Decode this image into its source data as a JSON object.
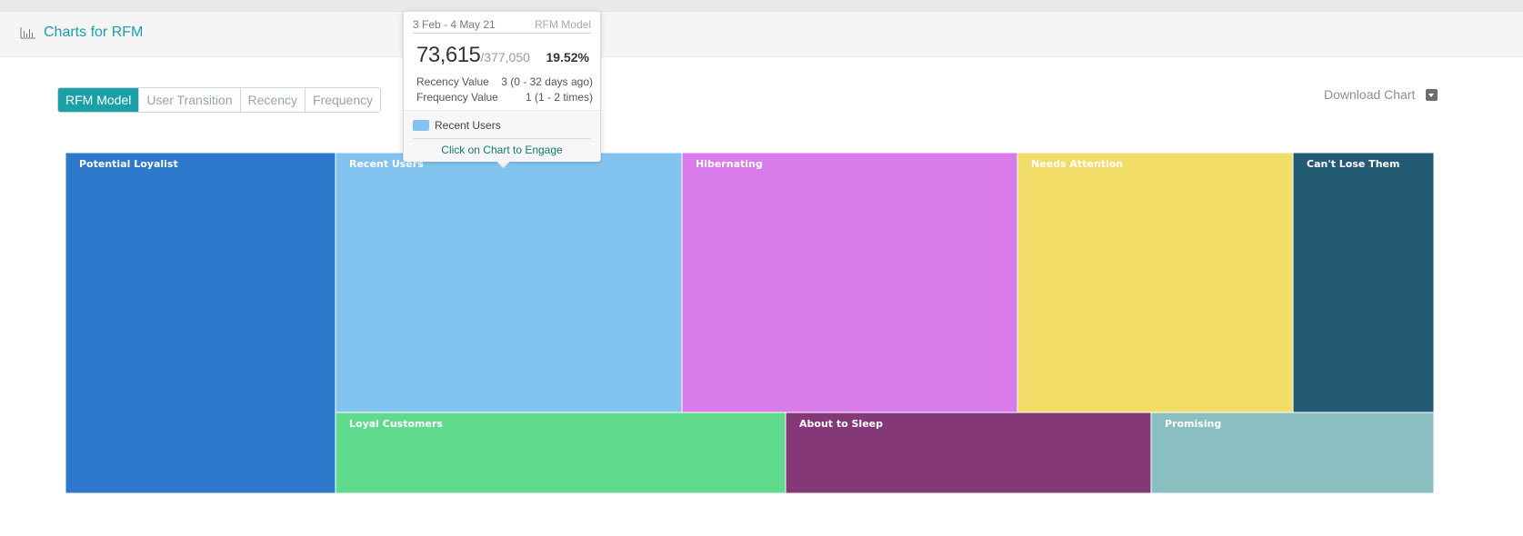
{
  "header": {
    "title": "Charts for RFM",
    "icon": "bar-chart-icon"
  },
  "tabs": [
    {
      "label": "RFM Model",
      "active": true
    },
    {
      "label": "User Transition",
      "active": false
    },
    {
      "label": "Recency",
      "active": false
    },
    {
      "label": "Frequency",
      "active": false
    }
  ],
  "download": {
    "label": "Download Chart",
    "icon": "chevron-down-icon"
  },
  "tooltip": {
    "date_range": "3 Feb - 4 May 21",
    "model": "RFM Model",
    "count": "73,615",
    "total": "/377,050",
    "percent": "19.52%",
    "recency_label": "Recency Value",
    "recency_value": "3 (0 - 32 days ago)",
    "frequency_label": "Frequency Value",
    "frequency_value": "1 (1 - 2 times)",
    "segment": "Recent Users",
    "segment_color": "#82c4ef",
    "cta": "Click on Chart to Engage"
  },
  "chart_data": {
    "type": "treemap",
    "title": "",
    "segments": [
      {
        "name": "Potential Loyalist",
        "color": "#2e78cb"
      },
      {
        "name": "Recent Users",
        "color": "#82c4ef",
        "value": 73615
      },
      {
        "name": "Hibernating",
        "color": "#d97bea"
      },
      {
        "name": "Needs Attention",
        "color": "#f2dd68"
      },
      {
        "name": "Can't Lose Them",
        "color": "#225b73"
      },
      {
        "name": "Loyal Customers",
        "color": "#60da8d"
      },
      {
        "name": "About to Sleep",
        "color": "#843878"
      },
      {
        "name": "Promising",
        "color": "#89bfc0"
      }
    ],
    "total": 377050
  }
}
